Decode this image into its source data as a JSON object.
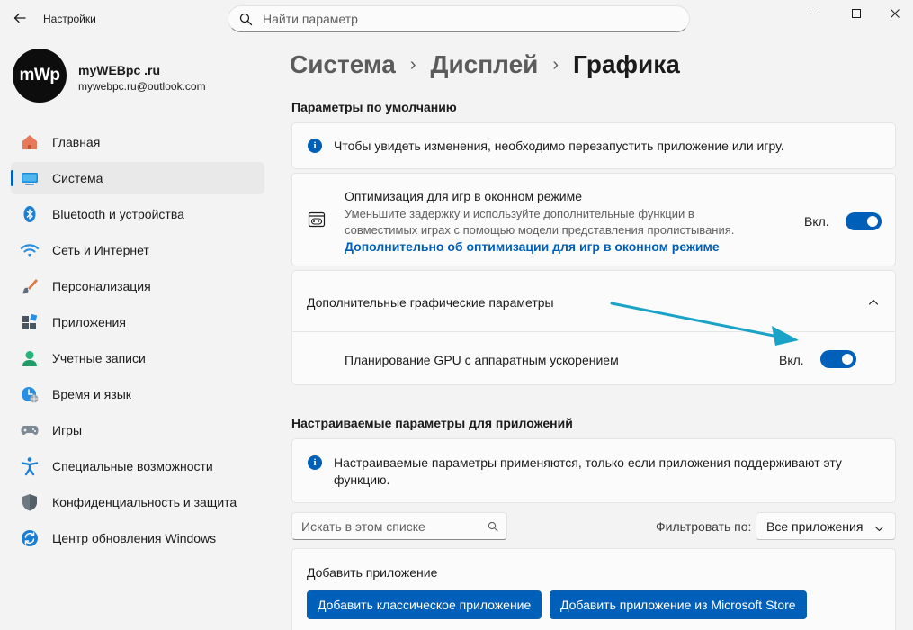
{
  "window": {
    "title": "Настройки",
    "search_placeholder": "Найти параметр"
  },
  "profile": {
    "avatar_text": "mWp",
    "name": "myWEBpc .ru",
    "email": "mywebpc.ru@outlook.com"
  },
  "sidebar": {
    "items": [
      {
        "label": "Главная",
        "icon": "home-icon"
      },
      {
        "label": "Система",
        "icon": "system-icon",
        "active": true
      },
      {
        "label": "Bluetooth и устройства",
        "icon": "bluetooth-icon"
      },
      {
        "label": "Сеть и Интернет",
        "icon": "wifi-icon"
      },
      {
        "label": "Персонализация",
        "icon": "brush-icon"
      },
      {
        "label": "Приложения",
        "icon": "apps-icon"
      },
      {
        "label": "Учетные записи",
        "icon": "account-icon"
      },
      {
        "label": "Время и язык",
        "icon": "time-language-icon"
      },
      {
        "label": "Игры",
        "icon": "gamepad-icon"
      },
      {
        "label": "Специальные возможности",
        "icon": "accessibility-icon"
      },
      {
        "label": "Конфиденциальность и защита",
        "icon": "shield-icon"
      },
      {
        "label": "Центр обновления Windows",
        "icon": "update-icon"
      }
    ]
  },
  "breadcrumb": {
    "level1": "Система",
    "level2": "Дисплей",
    "current": "Графика"
  },
  "defaults": {
    "title": "Параметры по умолчанию",
    "restart_notice": "Чтобы увидеть изменения, необходимо перезапустить приложение или игру.",
    "windowed": {
      "title": "Оптимизация для игр в оконном режиме",
      "desc_line1": "Уменьшите задержку и используйте дополнительные функции в",
      "desc_line2": "совместимых играх с помощью модели представления пролистывания.",
      "link": "Дополнительно об оптимизации для игр в оконном режиме",
      "state": "Вкл."
    },
    "advanced": {
      "title": "Дополнительные графические параметры",
      "gpu_label": "Планирование GPU с аппаратным ускорением",
      "gpu_state": "Вкл."
    }
  },
  "custom": {
    "title": "Настраиваемые параметры для приложений",
    "notice_line1": "Настраиваемые параметры применяются, только если приложения поддерживают эту",
    "notice_line2": "функцию.",
    "search_placeholder": "Искать в этом списке",
    "filter_label": "Фильтровать по:",
    "filter_value": "Все приложения",
    "add_title": "Добавить приложение",
    "add_classic": "Добавить классическое приложение",
    "add_store": "Добавить приложение из Microsoft Store"
  },
  "colors": {
    "accent": "#005fb8",
    "arrow": "#1aa3c7"
  }
}
